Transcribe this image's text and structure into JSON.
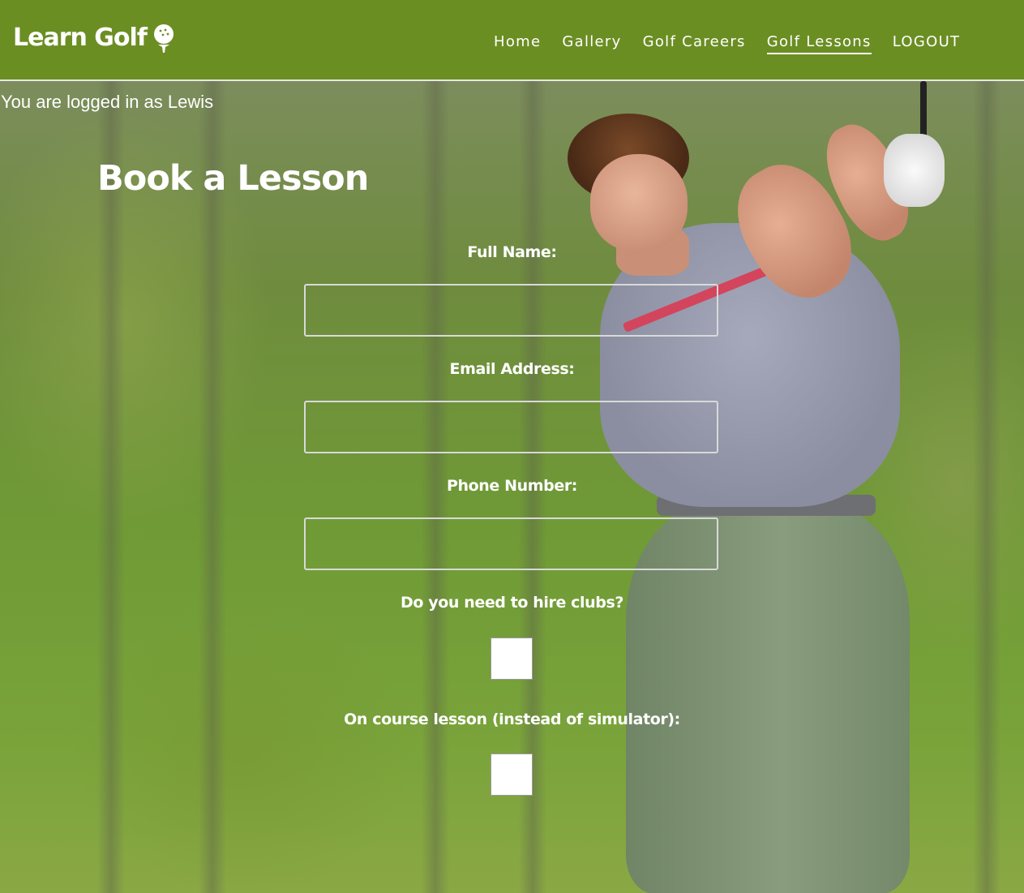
{
  "header": {
    "logo_text": "Learn Golf",
    "logo_icon": "golf-ball-on-tee-icon",
    "nav": [
      {
        "label": "Home",
        "active": false
      },
      {
        "label": "Gallery",
        "active": false
      },
      {
        "label": "Golf Careers",
        "active": false
      },
      {
        "label": "Golf Lessons",
        "active": true
      },
      {
        "label": "LOGOUT",
        "active": false
      }
    ]
  },
  "status": {
    "logged_in_text": "You are logged in as Lewis"
  },
  "form": {
    "title": "Book a Lesson",
    "full_name_label": "Full Name:",
    "full_name_value": "",
    "email_label": "Email Address:",
    "email_value": "",
    "phone_label": "Phone Number:",
    "phone_value": "",
    "hire_clubs_label": "Do you need to hire clubs?",
    "hire_clubs_checked": false,
    "on_course_label": "On course lesson (instead of simulator):",
    "on_course_checked": false
  },
  "colors": {
    "header_bg": "#6b8e23",
    "text": "#ffffff"
  }
}
